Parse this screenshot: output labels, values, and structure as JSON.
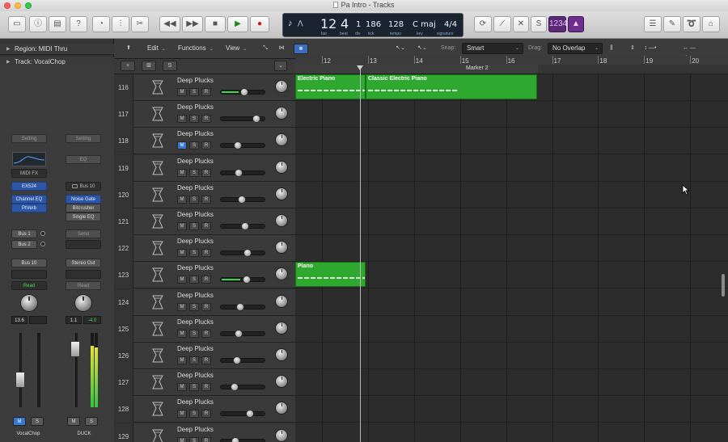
{
  "window": {
    "title": "Pa Intro - Tracks"
  },
  "lcd": {
    "bar": "12",
    "beat": "4",
    "div": "1",
    "tick": "186",
    "tempo": "128",
    "key": "C maj",
    "signature": "4/4",
    "labels": {
      "bar": "bar",
      "beat": "beat",
      "div": "div",
      "tick": "tick",
      "tempo": "tempo",
      "key": "key",
      "signature": "signature"
    }
  },
  "inspector": {
    "region_row": "Region: MIDI Thru",
    "track_row": "Track: VocalChop"
  },
  "strip_left": {
    "setting": "Setting",
    "midi_fx": "MIDI FX",
    "instrument": "EX524",
    "inserts": [
      "Channel EQ",
      "PtVerb"
    ],
    "sends": [
      "Bus 1",
      "Bus 2"
    ],
    "output": "Bus 10",
    "automation": "Read",
    "pan_value": "13.6",
    "name": "VocalChop",
    "mute": "M",
    "solo": "S"
  },
  "strip_right": {
    "setting": "Setting",
    "eq": "EQ",
    "input": "Bus 10",
    "inserts": [
      "Noise Gate",
      "Bitcrusher",
      "Single EQ"
    ],
    "send": "Send",
    "output": "Stereo Out",
    "automation": "Read",
    "pan_value": "1.1",
    "volume_value": "-4.0",
    "name": "DUCK",
    "mute": "M",
    "solo": "S"
  },
  "tracks_header": {
    "menus": [
      "Edit",
      "Functions",
      "View"
    ],
    "snap_label": "Snap:",
    "snap_value": "Smart",
    "drag_label": "Drag:",
    "drag_value": "No Overlap"
  },
  "ruler": {
    "bars": [
      "12",
      "13",
      "14",
      "15",
      "16",
      "17",
      "18",
      "19",
      "20"
    ],
    "marker": "Marker 2"
  },
  "tracks": [
    {
      "num": "116",
      "name": "Deep Plucks",
      "mute_on": false,
      "meter": 0.4,
      "vol": 0.52
    },
    {
      "num": "117",
      "name": "Deep Plucks",
      "mute_on": false,
      "meter": 0,
      "vol": 0.85
    },
    {
      "num": "118",
      "name": "Deep Plucks",
      "mute_on": true,
      "meter": 0,
      "vol": 0.35
    },
    {
      "num": "119",
      "name": "Deep Plucks",
      "mute_on": false,
      "meter": 0,
      "vol": 0.38
    },
    {
      "num": "120",
      "name": "Deep Plucks",
      "mute_on": false,
      "meter": 0,
      "vol": 0.45
    },
    {
      "num": "121",
      "name": "Deep Plucks",
      "mute_on": false,
      "meter": 0,
      "vol": 0.55
    },
    {
      "num": "122",
      "name": "Deep Plucks",
      "mute_on": false,
      "meter": 0,
      "vol": 0.6
    },
    {
      "num": "123",
      "name": "Deep Plucks",
      "mute_on": false,
      "meter": 0.45,
      "vol": 0.58
    },
    {
      "num": "124",
      "name": "Deep Plucks",
      "mute_on": false,
      "meter": 0,
      "vol": 0.42
    },
    {
      "num": "125",
      "name": "Deep Plucks",
      "mute_on": false,
      "meter": 0,
      "vol": 0.38
    },
    {
      "num": "126",
      "name": "Deep Plucks",
      "mute_on": false,
      "meter": 0,
      "vol": 0.33
    },
    {
      "num": "127",
      "name": "Deep Plucks",
      "mute_on": false,
      "meter": 0,
      "vol": 0.25
    },
    {
      "num": "128",
      "name": "Deep Plucks",
      "mute_on": false,
      "meter": 0,
      "vol": 0.68
    },
    {
      "num": "129",
      "name": "Deep Plucks",
      "mute_on": false,
      "meter": 0,
      "vol": 0.28
    }
  ],
  "track_buttons": {
    "mute": "M",
    "solo": "S",
    "rec": "R"
  },
  "regions": [
    {
      "track_index": 0,
      "title": "Electric Piano"
    },
    {
      "track_index": 0,
      "title": "Classic Electric Piano"
    },
    {
      "track_index": 7,
      "title": "Piano"
    }
  ],
  "colors": {
    "region": "#2fa82f",
    "accent_blue": "#3b78d2",
    "meter_green": "#3fd44e"
  }
}
